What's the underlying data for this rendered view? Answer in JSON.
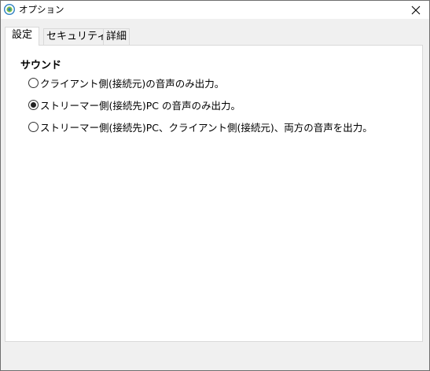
{
  "window": {
    "title": "オプション",
    "close_glyph": "✕"
  },
  "tabs": [
    {
      "label": "設定",
      "active": true
    },
    {
      "label": "セキュリティ",
      "active": false
    },
    {
      "label": "詳細",
      "active": false
    }
  ],
  "sound": {
    "group_title": "サウンド",
    "options": [
      {
        "label": "クライアント側(接続元)の音声のみ出力。",
        "selected": false
      },
      {
        "label": "ストリーマー側(接続先)PC の音声のみ出力。",
        "selected": true
      },
      {
        "label": "ストリーマー側(接続先)PC、クライアント側(接続元)、両方の音声を出力。",
        "selected": false
      }
    ]
  },
  "colors": {
    "app_icon": "#2d7fc1",
    "border": "#d9d9d9",
    "background": "#f0f0f0"
  },
  "icons": {
    "app": "app-logo-icon",
    "close": "close-icon",
    "radio": "radio-icon"
  }
}
